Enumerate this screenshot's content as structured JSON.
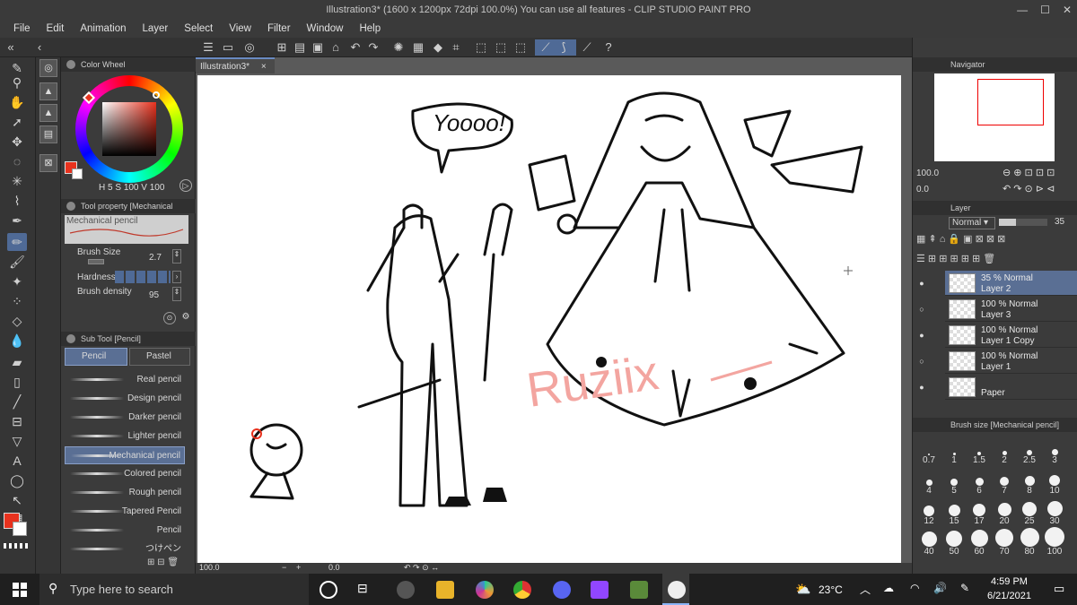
{
  "window": {
    "title": "Illustration3* (1600 x 1200px 72dpi 100.0%)  You can use all features - CLIP STUDIO PAINT PRO"
  },
  "menu": [
    "File",
    "Edit",
    "Animation",
    "Layer",
    "Select",
    "View",
    "Filter",
    "Window",
    "Help"
  ],
  "color_wheel": {
    "title": "Color Wheel",
    "readout_h": "5",
    "readout_s": "100",
    "readout_v": "100",
    "main_color": "#e8321e",
    "sub_color": "#ffffff"
  },
  "tool_property": {
    "title": "Tool property [Mechanical",
    "preset_name": "Mechanical pencil",
    "brush_size_label": "Brush Size",
    "brush_size_value": "2.7",
    "hardness_label": "Hardness",
    "density_label": "Brush density",
    "density_value": "95"
  },
  "sub_tool": {
    "title": "Sub Tool [Pencil]",
    "tabs": [
      "Pencil",
      "Pastel"
    ],
    "items": [
      "Real pencil",
      "Design pencil",
      "Darker pencil",
      "Lighter pencil",
      "Mechanical pencil",
      "Colored pencil",
      "Rough pencil",
      "Tapered Pencil",
      "Pencil",
      "つけペン"
    ]
  },
  "document": {
    "tab": "Illustration3*",
    "zoom": "100.0",
    "angle": "0.0"
  },
  "drawing": {
    "speech": "Yoooo!",
    "watermark": "Ruziix"
  },
  "navigator": {
    "title": "Navigator",
    "zoom": "100.0",
    "angle": "0.0"
  },
  "layer_panel": {
    "title": "Layer",
    "blend_mode": "Normal",
    "opacity": "35",
    "layers": [
      {
        "mode": "35 % Normal",
        "name": "Layer 2",
        "visible": true,
        "selected": true
      },
      {
        "mode": "100 % Normal",
        "name": "Layer 3",
        "visible": false,
        "selected": false
      },
      {
        "mode": "100 % Normal",
        "name": "Layer 1 Copy",
        "visible": true,
        "selected": false
      },
      {
        "mode": "100 % Normal",
        "name": "Layer 1",
        "visible": false,
        "selected": false
      },
      {
        "mode": "",
        "name": "Paper",
        "visible": true,
        "selected": false
      }
    ]
  },
  "brush_size_panel": {
    "title": "Brush size [Mechanical pencil]",
    "sizes": [
      "0.7",
      "1",
      "1.5",
      "2",
      "2.5",
      "3",
      "4",
      "5",
      "6",
      "7",
      "8",
      "10",
      "12",
      "15",
      "17",
      "20",
      "25",
      "30",
      "40",
      "50",
      "60",
      "70",
      "80",
      "100"
    ]
  },
  "taskbar": {
    "search_placeholder": "Type here to search",
    "weather": "23°C",
    "time": "4:59 PM",
    "date": "6/21/2021"
  }
}
